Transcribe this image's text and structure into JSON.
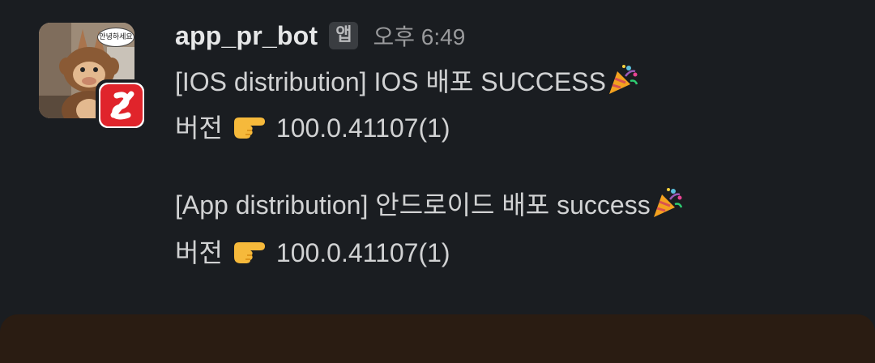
{
  "message": {
    "sender": "app_pr_bot",
    "app_tag": "앱",
    "timestamp": "오후 6:49",
    "avatar_bubble_text": "안녕하세요",
    "lines": {
      "ios_title": "[IOS distribution] IOS 배포 SUCCESS",
      "ios_version_label": "버전",
      "ios_version": "100.0.41107(1)",
      "app_title": "[App distribution] 안드로이드 배포 success",
      "app_version_label": "버전",
      "app_version": "100.0.41107(1)"
    },
    "emoji": {
      "celebration": "party-popper-icon",
      "pointer": "pointing-right-icon"
    }
  },
  "colors": {
    "background": "#1a1d21",
    "text": "#d1d2d3",
    "sender": "#e6e7e8",
    "timestamp": "#9a9b9d",
    "tag_bg": "#3a3d41",
    "badge_red": "#e0242b"
  }
}
